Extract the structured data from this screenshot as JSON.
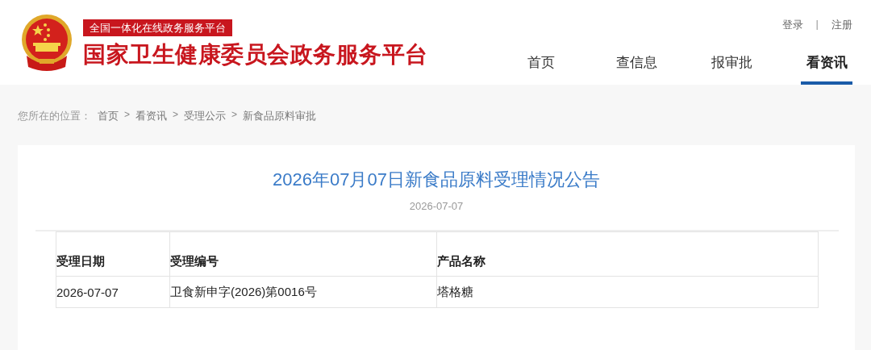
{
  "header": {
    "tagline": "全国一体化在线政务服务平台",
    "site_title": "国家卫生健康委员会政务服务平台",
    "auth": [
      {
        "kind": "link",
        "text": "登录"
      },
      {
        "kind": "separator",
        "text": "|"
      },
      {
        "kind": "link",
        "text": "注册"
      }
    ],
    "nav": [
      {
        "label": "首页",
        "selected": false
      },
      {
        "label": "查信息",
        "selected": false
      },
      {
        "label": "报审批",
        "selected": false
      },
      {
        "label": "看资讯",
        "selected": true
      }
    ]
  },
  "breadcrumb": [
    {
      "kind": "label",
      "text": "您所在的位置："
    },
    {
      "kind": "link",
      "text": "首页"
    },
    {
      "kind": "separator",
      "text": ">"
    },
    {
      "kind": "link",
      "text": "看资讯"
    },
    {
      "kind": "separator",
      "text": ">"
    },
    {
      "kind": "link",
      "text": "受理公示"
    },
    {
      "kind": "separator",
      "text": ">"
    },
    {
      "kind": "link",
      "text": "新食品原料审批"
    }
  ],
  "article": {
    "title": "2026年07月07日新食品原料受理情况公告",
    "date": "2026-07-07",
    "table": {
      "columns": [
        "受理日期",
        "受理编号",
        "产品名称"
      ],
      "rows": [
        [
          "2026-07-07",
          "卫食新申字(2026)第0016号",
          "塔格糖"
        ]
      ]
    }
  }
}
